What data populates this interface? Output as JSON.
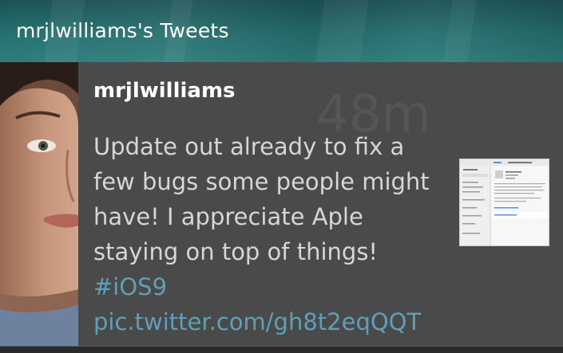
{
  "header": {
    "title": "mrjlwilliams's Tweets"
  },
  "tweet": {
    "username": "mrjlwilliams",
    "time": "48m",
    "text": "Update out already to fix a few bugs some people might have! I appreciate Aple staying on top of things!",
    "hashtag": "#iOS9",
    "link": "pic.twitter.com/gh8t2eqQQT"
  },
  "colors": {
    "header_bg": "#267070",
    "card_bg": "#4a4a4a",
    "link": "#5f9fb8",
    "text": "#d6d6d6"
  }
}
